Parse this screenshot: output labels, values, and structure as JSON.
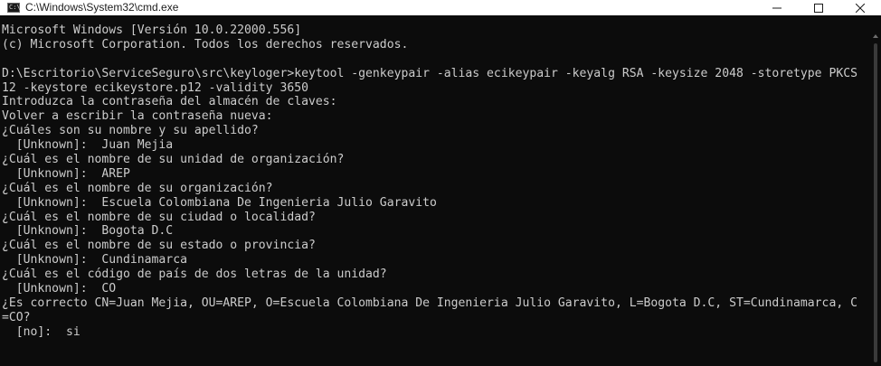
{
  "window": {
    "title": "C:\\Windows\\System32\\cmd.exe",
    "app_icon": "cmd-icon",
    "controls": [
      "minimize-icon",
      "maximize-icon",
      "close-icon"
    ]
  },
  "colors": {
    "background": "#0c0c0c",
    "text": "#cccccc",
    "titlebar": "#ffffff"
  },
  "console": {
    "lines": [
      "Microsoft Windows [Versión 10.0.22000.556]",
      "(c) Microsoft Corporation. Todos los derechos reservados.",
      "",
      "D:\\Escritorio\\ServiceSeguro\\src\\keyloger>keytool -genkeypair -alias ecikeypair -keyalg RSA -keysize 2048 -storetype PKCS",
      "12 -keystore ecikeystore.p12 -validity 3650",
      "Introduzca la contraseña del almacén de claves:",
      "Volver a escribir la contraseña nueva:",
      "¿Cuáles son su nombre y su apellido?",
      "  [Unknown]:  Juan Mejia",
      "¿Cuál es el nombre de su unidad de organización?",
      "  [Unknown]:  AREP",
      "¿Cuál es el nombre de su organización?",
      "  [Unknown]:  Escuela Colombiana De Ingenieria Julio Garavito",
      "¿Cuál es el nombre de su ciudad o localidad?",
      "  [Unknown]:  Bogota D.C",
      "¿Cuál es el nombre de su estado o provincia?",
      "  [Unknown]:  Cundinamarca",
      "¿Cuál es el código de país de dos letras de la unidad?",
      "  [Unknown]:  CO",
      "¿Es correcto CN=Juan Mejia, OU=AREP, O=Escuela Colombiana De Ingenieria Julio Garavito, L=Bogota D.C, ST=Cundinamarca, C",
      "=CO?",
      "  [no]:  si"
    ]
  }
}
